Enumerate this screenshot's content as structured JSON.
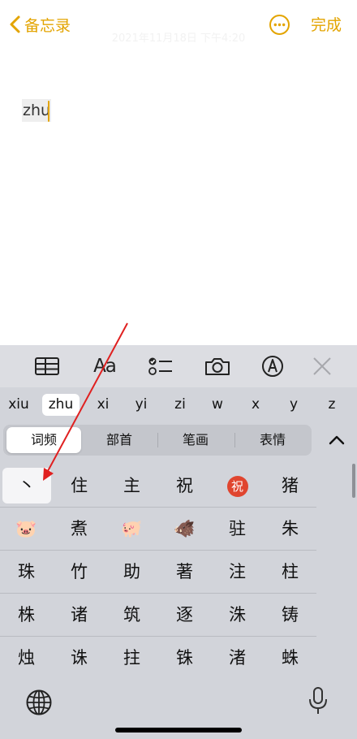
{
  "nav": {
    "back_label": "备忘录",
    "date_text": "2021年11月18日 下午4:20",
    "done_label": "完成",
    "more_icon": "ellipsis-circle-icon"
  },
  "editor": {
    "composing_text": "zhu"
  },
  "toolbar": {
    "items": [
      "table-icon",
      "Aa",
      "checklist-icon",
      "camera-icon",
      "markup-icon",
      "close-icon"
    ],
    "format_label": "Aa"
  },
  "pinyin": {
    "options": [
      "xiu",
      "zhu",
      "xi",
      "yi",
      "zi",
      "w",
      "x",
      "y",
      "z"
    ],
    "selected": "zhu"
  },
  "tabs": {
    "items": [
      "词频",
      "部首",
      "笔画",
      "表情"
    ],
    "active": "词频"
  },
  "candidates": {
    "rows": [
      [
        "丶",
        "住",
        "主",
        "祝",
        "祝",
        "猪"
      ],
      [
        "🐷",
        "煮",
        "🐖",
        "🐗",
        "驻",
        "朱"
      ],
      [
        "珠",
        "竹",
        "助",
        "著",
        "注",
        "柱"
      ],
      [
        "株",
        "诸",
        "筑",
        "逐",
        "洙",
        "铸"
      ],
      [
        "烛",
        "诛",
        "拄",
        "铢",
        "渚",
        "蛛"
      ]
    ]
  },
  "colors": {
    "accent": "#e3a400",
    "keyboard_bg": "#d2d4da",
    "annotation_arrow": "#e02020"
  }
}
